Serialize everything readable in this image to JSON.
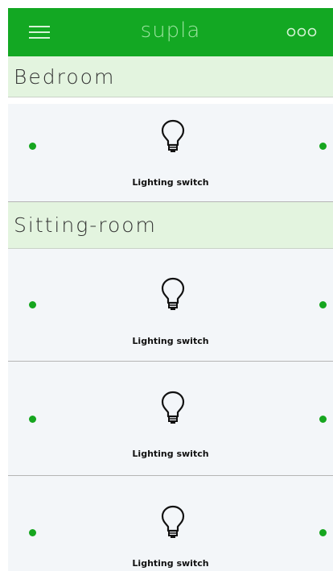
{
  "app": {
    "logo": "supla",
    "accent_color": "#13a823",
    "header_bg_color": "#e3f4df",
    "status_dot_color": "#16a61f",
    "menu_icon": "hamburger-menu-icon",
    "more_icon": "more-options-icon"
  },
  "locations": [
    {
      "name": "Bedroom",
      "channels": [
        {
          "caption": "Lighting switch",
          "icon": "light-bulb-icon"
        }
      ]
    },
    {
      "name": "Sitting-room",
      "channels": [
        {
          "caption": "Lighting switch",
          "icon": "light-bulb-icon"
        },
        {
          "caption": "Lighting switch",
          "icon": "light-bulb-icon"
        },
        {
          "caption": "Lighting switch",
          "icon": "light-bulb-icon"
        }
      ]
    }
  ]
}
